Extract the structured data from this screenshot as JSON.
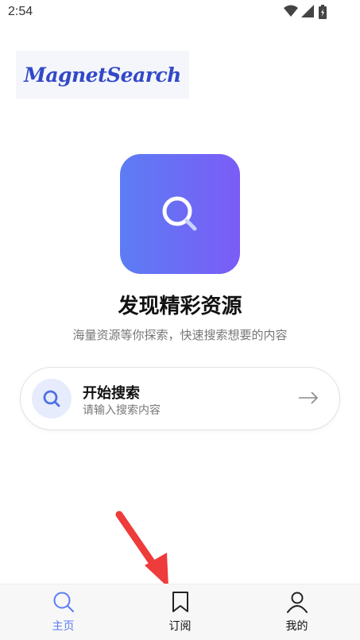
{
  "status_bar": {
    "time": "2:54"
  },
  "logo": {
    "text": "MagnetSearch"
  },
  "hero": {
    "title": "发现精彩资源",
    "subtitle": "海量资源等你探索，快速搜索想要的内容"
  },
  "search_card": {
    "title": "开始搜索",
    "hint": "请输入搜索内容"
  },
  "bottom_nav": {
    "items": [
      {
        "label": "主页",
        "icon": "search-icon",
        "active": true
      },
      {
        "label": "订阅",
        "icon": "bookmark-icon",
        "active": false
      },
      {
        "label": "我的",
        "icon": "person-icon",
        "active": false
      }
    ]
  },
  "colors": {
    "accent": "#5c7df4",
    "gradient_end": "#7b5cf6",
    "annotation_arrow": "#ee3b3b",
    "nav_bg": "#f7f7f7"
  }
}
